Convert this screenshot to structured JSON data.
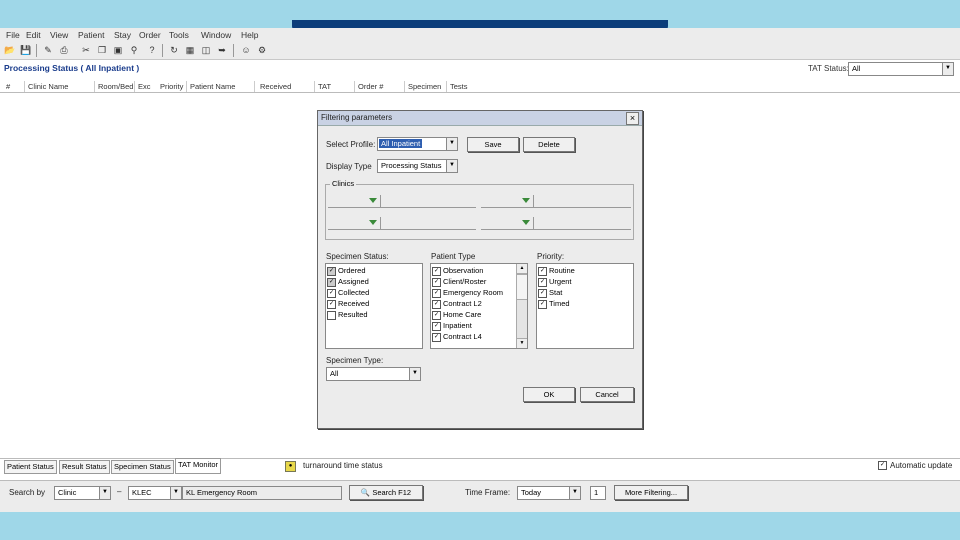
{
  "menu": [
    "File",
    "Edit",
    "View",
    "Patient",
    "Stay",
    "Order",
    "Tools",
    "Window",
    "Help"
  ],
  "toolbar_icons": [
    "open-icon",
    "save-icon",
    "new-icon",
    "print-icon",
    "cut-icon",
    "copy-icon",
    "paste-icon",
    "find-icon",
    "help-icon",
    "refresh-icon",
    "grid-icon",
    "filter-icon",
    "export-icon",
    "user-icon",
    "lock-icon"
  ],
  "status_row": {
    "title": "Processing Status ( All Inpatient )",
    "tat_label": "TAT Status:",
    "tat_value": "All"
  },
  "columns": [
    "#",
    "Clinic Name",
    "Room/Bed",
    "Exc",
    "Priority",
    "Patient Name",
    "Received",
    "TAT",
    "Order #",
    "Specimen",
    "Tests"
  ],
  "bottom_tabs": [
    "Patient Status",
    "Result Status",
    "Specimen Status",
    "TAT Monitor"
  ],
  "bottom_info": {
    "status_text": "turnaround time status",
    "auto_update": "Automatic update"
  },
  "search_row": {
    "search_by_label": "Search by",
    "search_by_value": "Clinic",
    "dash": "–",
    "code_value": "KLEC",
    "desc_value": "KL Emergency Room",
    "search_button": "Search F12",
    "time_frame_label": "Time Frame:",
    "time_frame_value": "Today",
    "number_value": "1",
    "more_filter_button": "More Filtering..."
  },
  "dialog": {
    "title": "Filtering parameters",
    "select_profile_label": "Select Profile:",
    "select_profile_value": "All Inpatient",
    "save_button": "Save",
    "delete_button": "Delete",
    "display_type_label": "Display Type",
    "display_type_value": "Processing Status",
    "clinics_label": "Clinics",
    "specimen_status_label": "Specimen Status:",
    "specimen_status": [
      {
        "label": "Ordered",
        "checked": true,
        "gray": true
      },
      {
        "label": "Assigned",
        "checked": true,
        "gray": true
      },
      {
        "label": "Collected",
        "checked": true,
        "gray": false
      },
      {
        "label": "Received",
        "checked": true,
        "gray": false
      },
      {
        "label": "Resulted",
        "checked": false,
        "gray": false
      }
    ],
    "patient_type_label": "Patient Type",
    "patient_type": [
      {
        "label": "Observation",
        "checked": true
      },
      {
        "label": "Client/Roster",
        "checked": true
      },
      {
        "label": "Emergency Room",
        "checked": true
      },
      {
        "label": "Contract L2",
        "checked": true
      },
      {
        "label": "Home Care",
        "checked": true
      },
      {
        "label": "Inpatient",
        "checked": true
      },
      {
        "label": "Contract L4",
        "checked": true
      }
    ],
    "priority_label": "Priority:",
    "priority": [
      {
        "label": "Routine",
        "checked": true
      },
      {
        "label": "Urgent",
        "checked": true
      },
      {
        "label": "Stat",
        "checked": true
      },
      {
        "label": "Timed",
        "checked": true
      }
    ],
    "specimen_type_label": "Specimen Type:",
    "specimen_type_value": "All",
    "ok_button": "OK",
    "cancel_button": "Cancel"
  }
}
